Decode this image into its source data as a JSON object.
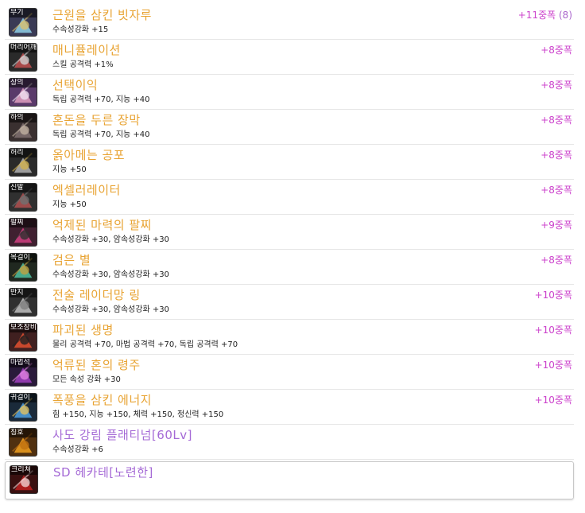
{
  "colors": {
    "epic_name": "#e8a332",
    "unique_name": "#a56ad6",
    "star_force": "#cc44cc"
  },
  "items": [
    {
      "slot": "무기",
      "name": "근원을 삼킨 빗자루",
      "option": "수속성강화 +15",
      "star": "+11중폭",
      "extra": "(8)",
      "tier": "gold",
      "icon": "weapon-broom-icon"
    },
    {
      "slot": "머리어깨",
      "name": "매니퓰레이션",
      "option": "스킬 공격력 +1%",
      "star": "+8중폭",
      "extra": "",
      "tier": "gold",
      "icon": "shoulder-armor-icon"
    },
    {
      "slot": "상의",
      "name": "선택이익",
      "option": "독립 공격력 +70, 지능 +40",
      "star": "+8중폭",
      "extra": "",
      "tier": "gold",
      "icon": "top-armor-icon"
    },
    {
      "slot": "하의",
      "name": "혼돈을 두른 장막",
      "option": "독립 공격력 +70, 지능 +40",
      "star": "+8중폭",
      "extra": "",
      "tier": "gold",
      "icon": "bottom-armor-icon"
    },
    {
      "slot": "허리",
      "name": "옭아메는 공포",
      "option": "지능 +50",
      "star": "+8중폭",
      "extra": "",
      "tier": "gold",
      "icon": "belt-icon"
    },
    {
      "slot": "신발",
      "name": "엑셀러레이터",
      "option": "지능 +50",
      "star": "+8중폭",
      "extra": "",
      "tier": "gold",
      "icon": "shoes-icon"
    },
    {
      "slot": "팔찌",
      "name": "억제된 마력의 팔찌",
      "option": "수속성강화 +30, 암속성강화 +30",
      "star": "+9중폭",
      "extra": "",
      "tier": "gold",
      "icon": "bracelet-icon"
    },
    {
      "slot": "목걸이",
      "name": "검은 별",
      "option": "수속성강화 +30, 암속성강화 +30",
      "star": "+8중폭",
      "extra": "",
      "tier": "gold",
      "icon": "necklace-icon"
    },
    {
      "slot": "반지",
      "name": "전술 레이더망 링",
      "option": "수속성강화 +30, 암속성강화 +30",
      "star": "+10중폭",
      "extra": "",
      "tier": "gold",
      "icon": "ring-icon"
    },
    {
      "slot": "보조장비",
      "name": "파괴된 생명",
      "option": "물리 공격력 +70, 마법 공격력 +70, 독립 공격력 +70",
      "star": "+10중폭",
      "extra": "",
      "tier": "gold",
      "icon": "sub-equipment-icon"
    },
    {
      "slot": "마법석",
      "name": "억류된 혼의 령주",
      "option": "모든 속성 강화 +30",
      "star": "+10중폭",
      "extra": "",
      "tier": "gold",
      "icon": "magic-stone-icon"
    },
    {
      "slot": "귀걸이",
      "name": "폭풍을 삼킨 에너지",
      "option": "힘 +150, 지능 +150, 체력 +150, 정신력 +150",
      "star": "+10중폭",
      "extra": "",
      "tier": "gold",
      "icon": "earring-icon"
    },
    {
      "slot": "칭호",
      "name": "사도 강림 플래티넘[60Lv]",
      "option": "수속성강화 +6",
      "star": "",
      "extra": "",
      "tier": "purple",
      "icon": "title-emblem-icon"
    },
    {
      "slot": "크리쳐",
      "name": "SD 헤카테[노련한]",
      "option": "",
      "star": "",
      "extra": "",
      "tier": "purple",
      "icon": "creature-icon"
    }
  ]
}
